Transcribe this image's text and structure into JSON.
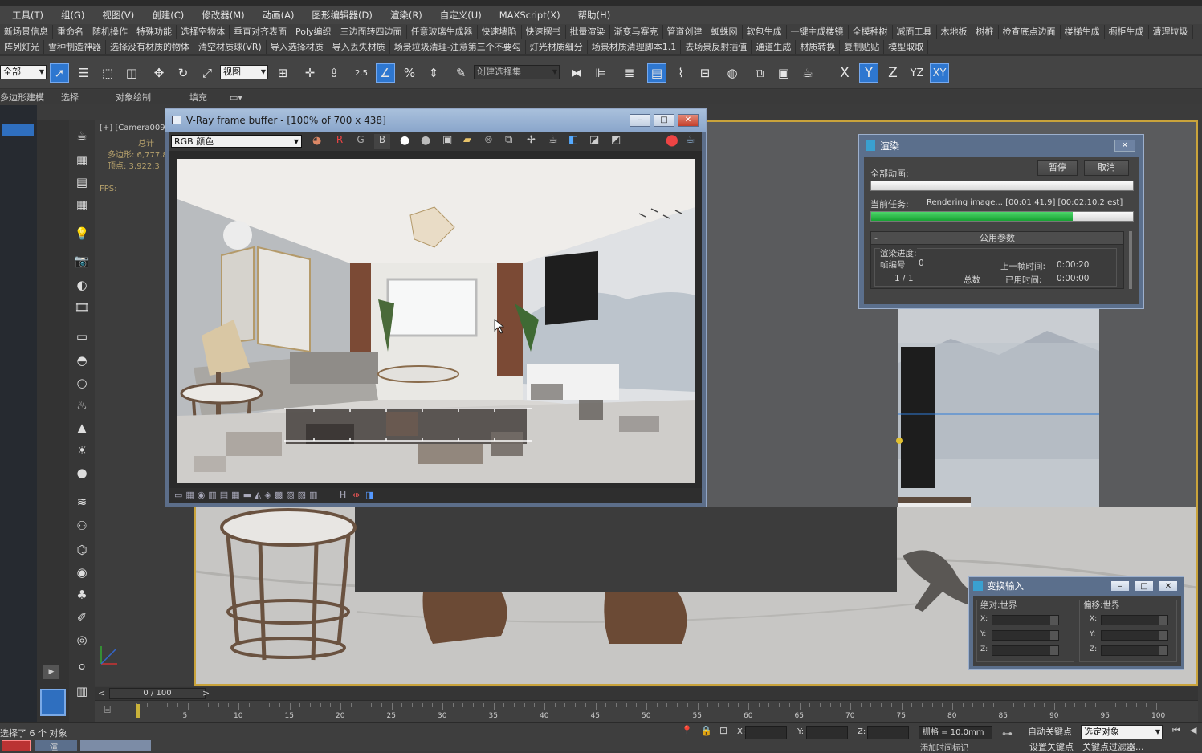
{
  "menu": [
    "工具(T)",
    "组(G)",
    "视图(V)",
    "创建(C)",
    "修改器(M)",
    "动画(A)",
    "图形编辑器(D)",
    "渲染(R)",
    "自定义(U)",
    "MAXScript(X)",
    "帮助(H)"
  ],
  "plugins_row1": [
    "新场景信息",
    "重命名",
    "随机操作",
    "特殊功能",
    "选择空物体",
    "垂直对齐表面",
    "Poly编织",
    "三边面转四边面",
    "任意玻璃生成器",
    "快速墙陷",
    "快速摆书",
    "批量渲染",
    "渐变马赛克",
    "管道创建",
    "蜘蛛网",
    "软包生成",
    "一键主成楼镜",
    "全模种树",
    "减面工具",
    "木地板",
    "树桩",
    "检查底点边面",
    "楼梯生成",
    "橱柜生成",
    "清理垃圾"
  ],
  "plugins_row2": [
    "阵列灯光",
    "雪种制造神器",
    "选择没有材质的物体",
    "清空材质球(VR)",
    "导入选择材质",
    "导入丢失材质",
    "场景垃圾清理-注意第三个不要勾",
    "灯光材质细分",
    "场景材质清理脚本1.1",
    "去场景反射插值",
    "通道生成",
    "材质转换",
    "复制贴贴",
    "模型取取"
  ],
  "toolbar": {
    "filter_dropdown": "全部",
    "refcoord_dropdown": "视图",
    "selset_dropdown": "创建选择集",
    "snap_label": "2.5",
    "axis_x": "X",
    "axis_y": "Y",
    "axis_z": "Z",
    "axis_yz": "YZ",
    "axis_xy": "XY"
  },
  "ribbon": [
    "多边形建模",
    "选择",
    "对象绘制",
    "填充"
  ],
  "viewport": {
    "label": "[+] [Camera009",
    "stats_total": "总计",
    "stats_poly": "多边形: 6,777,8",
    "stats_verts": "顶点: 3,922,3",
    "fps": "FPS:"
  },
  "vray_fb": {
    "title": "V-Ray frame buffer - [100% of 700 x 438]",
    "channel": "RGB 颜色",
    "btn_r": "R",
    "btn_g": "G",
    "btn_b": "B",
    "status_h": "H"
  },
  "render_dialog": {
    "title": "渲染",
    "all_anim_label": "全部动画:",
    "pause": "暂停",
    "cancel": "取消",
    "current_task_label": "当前任务:",
    "current_task": "Rendering image... [00:01:41.9] [00:02:10.2 est]",
    "progress": 0.77,
    "section": "公用参数",
    "progress_group": "渲染进度:",
    "frame_label": "帧编号",
    "frame_value": "0",
    "frame_count": "1 / 1",
    "total_label": "总数",
    "last_frame_label": "上一帧时间:",
    "last_frame_time": "0:00:20",
    "elapsed_label": "已用时间:",
    "elapsed_time": "0:00:00"
  },
  "transform_dialog": {
    "title": "变换输入",
    "absolute": "绝对:世界",
    "offset": "偏移:世界",
    "x": "X:",
    "y": "Y:",
    "z": "Z:"
  },
  "timeline": {
    "slider": "0 / 100",
    "ticks": [
      "5",
      "10",
      "15",
      "20",
      "25",
      "30",
      "35",
      "40",
      "45",
      "50",
      "55",
      "60",
      "65",
      "70",
      "75",
      "80",
      "85",
      "90",
      "95",
      "100"
    ]
  },
  "status": {
    "selection": "选择了 6 个 对象",
    "x_label": "X:",
    "y_label": "Y:",
    "z_label": "Z:",
    "grid": "栅格 = 10.0mm",
    "auto_key": "自动关键点",
    "selected_object": "选定对象",
    "set_key": "设置关键点",
    "key_filter": "关键点过滤器...",
    "add_time_tag": "添加时间标记",
    "taskbar_item": "渲"
  },
  "colors": {
    "accent": "#2e77d0",
    "viewport_border": "#c9a33b",
    "progress_green": "#1bb33a"
  }
}
